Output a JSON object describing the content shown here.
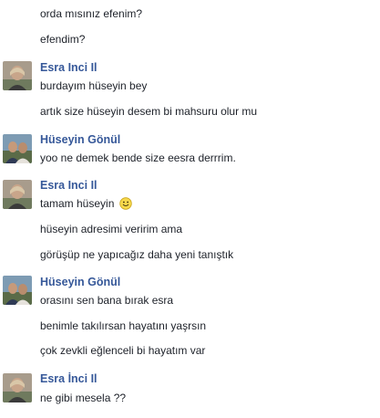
{
  "conversation": {
    "top_messages": [
      "orda mısınız efenim?",
      "efendim?"
    ],
    "groups": [
      {
        "sender": "Esra Inci Il",
        "avatar": "esra-avatar",
        "messages": [
          "burdayım hüseyin bey",
          "artık size hüseyin desem bi mahsuru olur mu"
        ]
      },
      {
        "sender": "Hüseyin Gönül",
        "avatar": "huseyin-avatar",
        "messages": [
          "yoo ne demek bende size eesra derrrim."
        ]
      },
      {
        "sender": "Esra Inci Il",
        "avatar": "esra-avatar",
        "messages": [
          "tamam hüseyin",
          "hüseyin adresimi veririm ama",
          "görüşüp ne yapıcağız daha yeni tanıştık"
        ],
        "emoji": "smile-emoji"
      },
      {
        "sender": "Hüseyin Gönül",
        "avatar": "huseyin-avatar",
        "messages": [
          "orasını sen bana bırak esra",
          "benimle takılırsan hayatını yaşrsın",
          "çok zevkli eğlenceli bi hayatım var"
        ]
      },
      {
        "sender": "Esra İnci Il",
        "avatar": "esra-avatar",
        "messages": [
          "ne gibi mesela ??"
        ]
      }
    ]
  }
}
